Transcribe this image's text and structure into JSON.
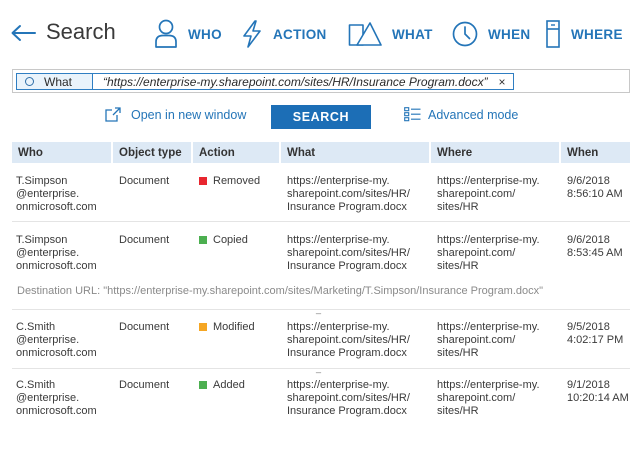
{
  "header": {
    "title": "Search",
    "nav": [
      {
        "label": "WHO",
        "icon": "user-icon"
      },
      {
        "label": "ACTION",
        "icon": "lightning-icon"
      },
      {
        "label": "WHAT",
        "icon": "triangles-icon"
      },
      {
        "label": "WHEN",
        "icon": "clock-icon"
      },
      {
        "label": "WHERE",
        "icon": "database-icon"
      }
    ]
  },
  "filter": {
    "field": "What",
    "value": "“https://enterprise-my.sharepoint.com/sites/HR/Insurance Program.docx”",
    "close": "×"
  },
  "actions": {
    "open_window": "Open in new window",
    "search": "SEARCH",
    "advanced": "Advanced mode"
  },
  "table": {
    "columns": [
      "Who",
      "Object type",
      "Action",
      "What",
      "Where",
      "When"
    ],
    "rows": [
      {
        "who": [
          "T.Simpson",
          "@enterprise.",
          "onmicrosoft.com"
        ],
        "object_type": "Document",
        "action": "Removed",
        "action_color": "#e8262f",
        "what": [
          "https://enterprise-my.",
          "sharepoint.com/sites/HR/",
          "Insurance Program.docx"
        ],
        "where": [
          "https://enterprise-my.",
          "sharepoint.com/",
          "sites/HR"
        ],
        "when": [
          "9/6/2018",
          "8:56:10 AM"
        ]
      },
      {
        "who": [
          "T.Simpson",
          "@enterprise.",
          "onmicrosoft.com"
        ],
        "object_type": "Document",
        "action": "Copied",
        "action_color": "#4caf50",
        "what": [
          "https://enterprise-my.",
          "sharepoint.com/sites/HR/",
          "Insurance Program.docx"
        ],
        "where": [
          "https://enterprise-my.",
          "sharepoint.com/",
          "sites/HR"
        ],
        "when": [
          "9/6/2018",
          "8:53:45 AM"
        ],
        "destination": "Destination URL: \"https://enterprise-my.sharepoint.com/sites/Marketing/T.Simpson/Insurance Program.docx\""
      },
      {
        "who": [
          "C.Smith",
          "@enterprise.",
          "onmicrosoft.com"
        ],
        "object_type": "Document",
        "action": "Modified",
        "action_color": "#f5a623",
        "what": [
          "https://enterprise-my.",
          "sharepoint.com/sites/HR/",
          "Insurance Program.docx"
        ],
        "where": [
          "https://enterprise-my.",
          "sharepoint.com/",
          "sites/HR"
        ],
        "when": [
          "9/5/2018",
          "4:02:17 PM"
        ]
      },
      {
        "who": [
          "C.Smith",
          "@enterprise.",
          "onmicrosoft.com"
        ],
        "object_type": "Document",
        "action": "Added",
        "action_color": "#4caf50",
        "what": [
          "https://enterprise-my.",
          "sharepoint.com/sites/HR/",
          "Insurance Program.docx"
        ],
        "where": [
          "https://enterprise-my.",
          "sharepoint.com/",
          "sites/HR"
        ],
        "when": [
          "9/1/2018",
          "10:20:14 AM"
        ]
      }
    ]
  }
}
